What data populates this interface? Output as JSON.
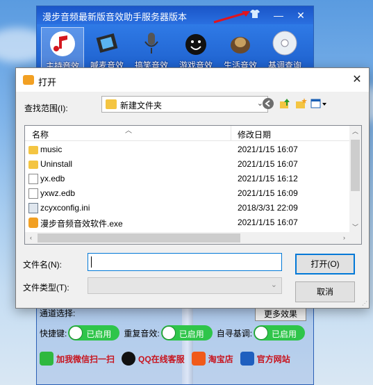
{
  "app": {
    "title": "漫步音频最新版音效助手服务器版本",
    "toolbar": [
      {
        "label": "主持音效",
        "icon": "music-note-icon",
        "active": true
      },
      {
        "label": "喊麦音效",
        "icon": "film-icon",
        "active": false
      },
      {
        "label": "搞笑音效",
        "icon": "microphone-icon",
        "active": false
      },
      {
        "label": "游戏音效",
        "icon": "smiley-bomb-icon",
        "active": false
      },
      {
        "label": "生活音效",
        "icon": "dog-icon",
        "active": false
      },
      {
        "label": "基调查询",
        "icon": "cd-icon",
        "active": false
      }
    ],
    "partial_label": "通道选择:",
    "more_button": "更多效果",
    "toggles_row": {
      "hotkey_label": "快捷键:",
      "repeat_label": "重复音效:",
      "seek_label": "自寻基调:",
      "toggle_text": "已启用"
    },
    "links": [
      {
        "label": "加我微信扫一扫",
        "icon": "wechat-icon",
        "color": "#2fb83f"
      },
      {
        "label": "QQ在线客服",
        "icon": "qq-icon",
        "color": "#111111"
      },
      {
        "label": "淘宝店",
        "icon": "taobao-icon",
        "color": "#f05a1a"
      },
      {
        "label": "官方网站",
        "icon": "home-icon",
        "color": "#1f5fbf"
      }
    ]
  },
  "dialog": {
    "title": "打开",
    "lookin_label": "查找范围(I):",
    "lookin_value": "新建文件夹",
    "columns": {
      "name": "名称",
      "modified": "修改日期"
    },
    "files": [
      {
        "name": "music",
        "date": "2021/1/15 16:07",
        "type": "folder"
      },
      {
        "name": "Uninstall",
        "date": "2021/1/15 16:07",
        "type": "folder"
      },
      {
        "name": "yx.edb",
        "date": "2021/1/15 16:12",
        "type": "file"
      },
      {
        "name": "yxwz.edb",
        "date": "2021/1/15 16:09",
        "type": "file"
      },
      {
        "name": "zcyxconfig.ini",
        "date": "2018/3/31 22:09",
        "type": "cfg"
      },
      {
        "name": "漫步音频音效软件.exe",
        "date": "2021/1/15 16:07",
        "type": "exe"
      }
    ],
    "filename_label": "文件名(N):",
    "filename_value": "",
    "filetype_label": "文件类型(T):",
    "filetype_value": "",
    "open_button": "打开(O)",
    "cancel_button": "取消"
  },
  "colors": {
    "accent": "#0078d7",
    "app_blue": "#1a56c8",
    "toggle_green": "#2fc54a",
    "link_red": "#c8141e"
  }
}
